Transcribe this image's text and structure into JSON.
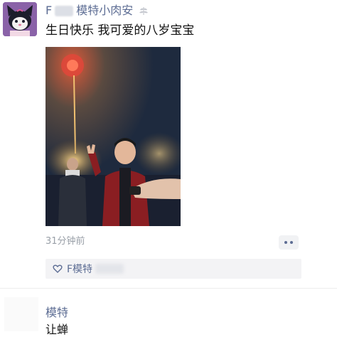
{
  "post": {
    "username_prefix": "F",
    "username_suffix": "模特小肉安",
    "text": "生日快乐 我可爱的八岁宝宝",
    "timestamp": "31分钟前"
  },
  "likes": {
    "text": "F模特"
  },
  "comment": {
    "author": "模特",
    "text": "让蝉"
  },
  "icons": {
    "avatar": "cartoon-character-avatar",
    "badge": "wheat-badge-icon",
    "heart": "heart-icon",
    "more": "more-dots-icon"
  },
  "colors": {
    "link": "#5c6c93",
    "text": "#111111",
    "meta": "#9aa0a8",
    "panel": "#f3f3f5"
  }
}
